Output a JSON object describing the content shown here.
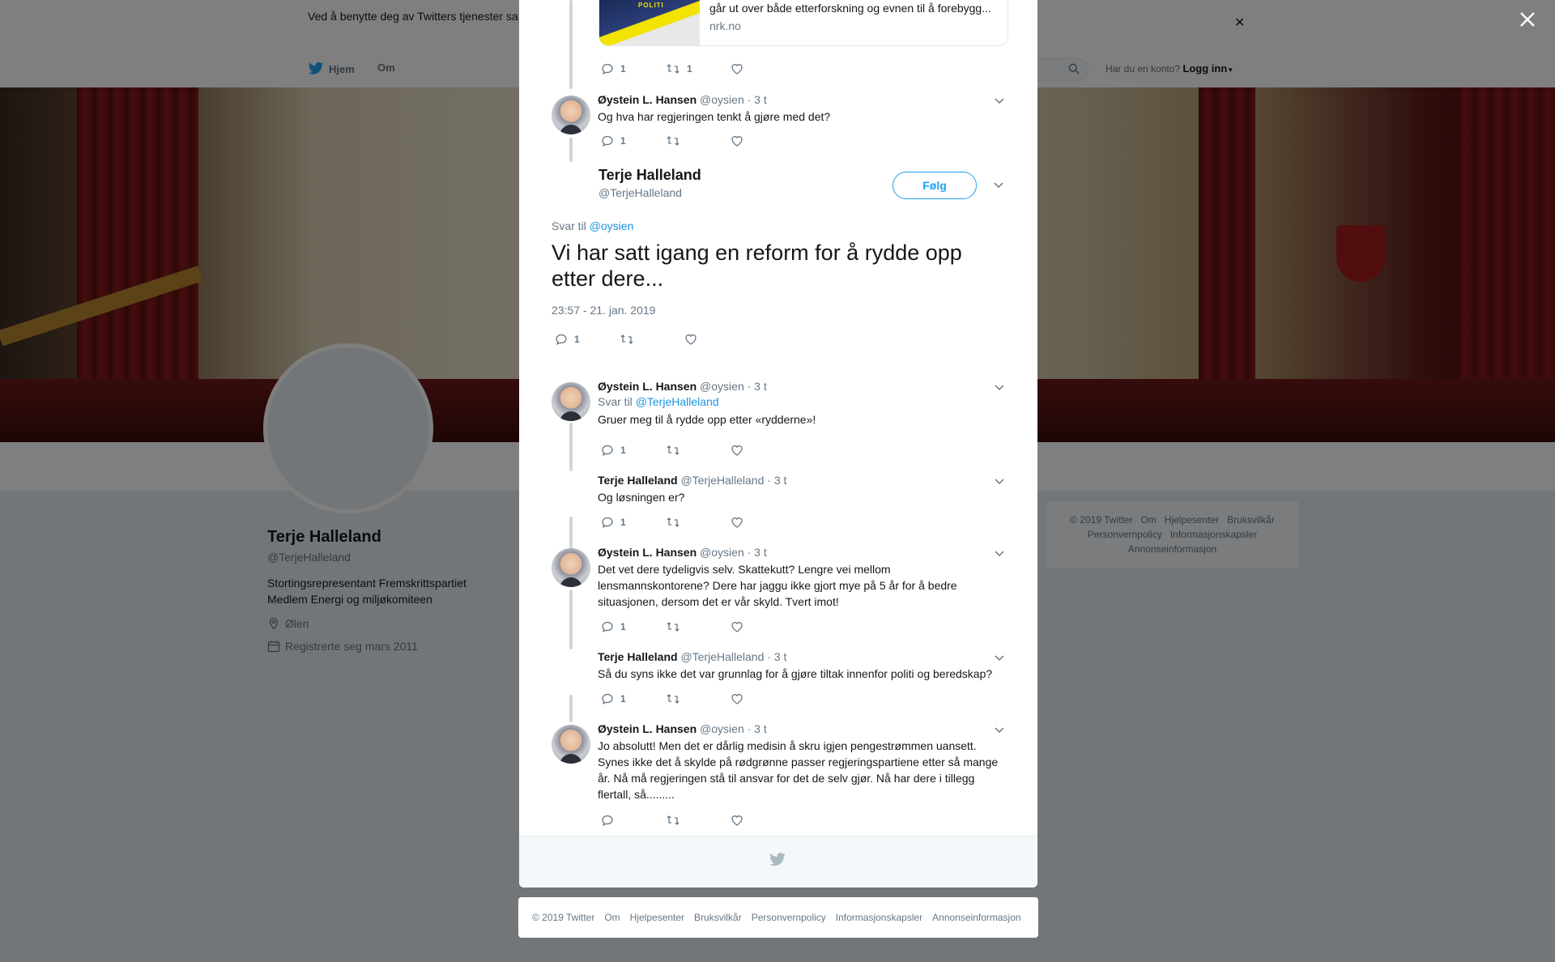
{
  "cookie_banner": {
    "text": "Ved å benytte deg av Twitters tjenester sa... informasjonskapsler til bl.a. analyser, personalisering og annonser."
  },
  "nav": {
    "home": "Hjem",
    "about": "Om",
    "account_prompt": "Har du en konto?",
    "login": "Logg inn"
  },
  "profile": {
    "name": "Terje Halleland",
    "handle": "@TerjeHalleland",
    "bio_line1": "Stortingsrepresentant Fremskrittspartiet",
    "bio_line2": "Medlem Energi og miljøkomiteen",
    "location": "Ølen",
    "joined": "Registrerte seg mars 2011"
  },
  "side_footer": {
    "links": [
      "© 2019 Twitter",
      "Om",
      "Hjelpesenter",
      "Bruksvilkår",
      "Personvernpolicy",
      "Informasjonskapsler",
      "Annonseinformasjon"
    ]
  },
  "link_card": {
    "image_text": "POLITI",
    "title": "går ut over både etterforskning og evnen til å forebygg...",
    "domain": "nrk.no"
  },
  "card_actions": {
    "replies": "1",
    "retweets": "1"
  },
  "tweets": [
    {
      "name": "Øystein L. Hansen",
      "handle": "@oysien",
      "time": "· 3 t",
      "reply_to_prefix": "",
      "reply_to": "",
      "text": "Og hva har regjeringen tenkt å gjøre med det?",
      "replies": "1"
    },
    {
      "name": "Øystein L. Hansen",
      "handle": "@oysien",
      "time": "· 3 t",
      "reply_to_prefix": "Svar til",
      "reply_to": "@TerjeHalleland",
      "text": "Gruer meg til å rydde opp etter «rydderne»!",
      "replies": "1"
    },
    {
      "name": "Terje Halleland",
      "handle": "@TerjeHalleland",
      "time": "· 3 t",
      "reply_to_prefix": "",
      "reply_to": "",
      "text": "Og løsningen er?",
      "replies": "1"
    },
    {
      "name": "Øystein L. Hansen",
      "handle": "@oysien",
      "time": "· 3 t",
      "reply_to_prefix": "",
      "reply_to": "",
      "text": "Det vet dere tydeligvis selv. Skattekutt? Lengre vei mellom lensmannskontorene? Dere har jaggu ikke gjort mye på 5 år for å bedre situasjonen, dersom det er vår skyld. Tvert imot!",
      "replies": "1"
    },
    {
      "name": "Terje Halleland",
      "handle": "@TerjeHalleland",
      "time": "· 3 t",
      "reply_to_prefix": "",
      "reply_to": "",
      "text": "Så du syns ikke det var grunnlag for å gjøre tiltak innenfor politi og beredskap?",
      "replies": "1"
    },
    {
      "name": "Øystein L. Hansen",
      "handle": "@oysien",
      "time": "· 3 t",
      "reply_to_prefix": "",
      "reply_to": "",
      "text": "Jo absolutt! Men det er dårlig medisin å skru igjen pengestrømmen uansett. Synes ikke det å skylde på rødgrønne passer regjeringspartiene etter så mange år. Nå må regjeringen stå til ansvar for det de selv gjør. Nå har dere i tillegg flertall, så.........",
      "replies": ""
    }
  ],
  "main_tweet": {
    "name": "Terje Halleland",
    "handle": "@TerjeHalleland",
    "follow_label": "Følg",
    "reply_to_prefix": "Svar til",
    "reply_to": "@oysien",
    "text": "Vi har satt igang en reform for å rydde opp etter dere...",
    "timestamp": "23:57 - 21. jan. 2019",
    "replies": "1"
  },
  "bottom_footer": {
    "links": [
      "© 2019 Twitter",
      "Om",
      "Hjelpesenter",
      "Bruksvilkår",
      "Personvernpolicy",
      "Informasjonskapsler",
      "Annonseinformasjon"
    ]
  },
  "icons": {
    "reply": "reply-icon",
    "retweet": "retweet-icon",
    "like": "heart-icon",
    "caret": "chevron-down-icon",
    "close": "close-icon",
    "bird": "twitter-bird-icon"
  },
  "colors": {
    "accent": "#1da1f2",
    "link": "#1b95e0",
    "muted": "#657786"
  }
}
